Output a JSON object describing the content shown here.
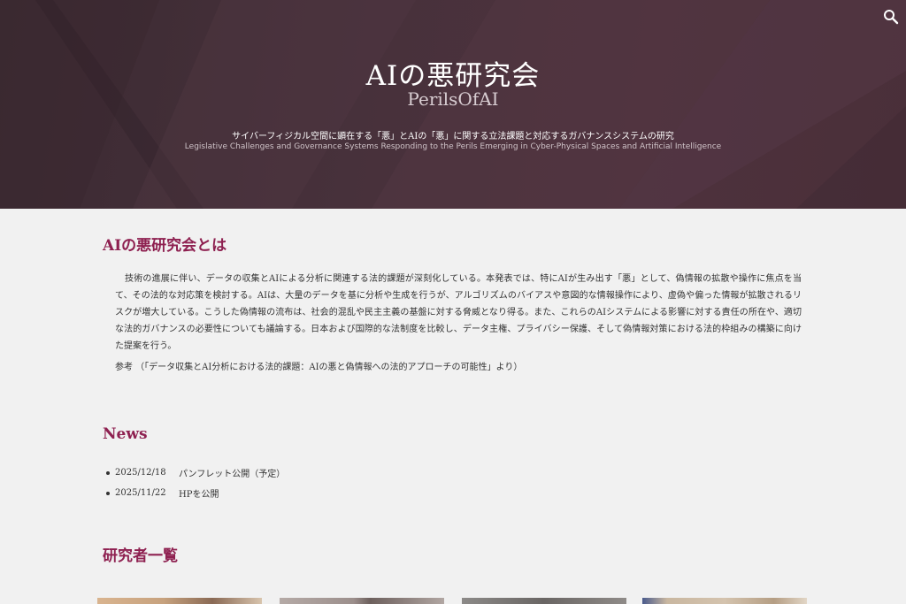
{
  "colors": {
    "hero_bg": "#47313b",
    "accent": "#8e2050",
    "page_bg": "#f1f1f1"
  },
  "header": {
    "search_icon": "search-icon",
    "title": "AIの悪研究会",
    "subtitle": "PerilsOfAI",
    "tagline_ja": "サイバーフィジカル空間に顕在する「悪」とAIの「悪」に関する立法課題と対応するガバナンスシステムの研究",
    "tagline_en": "Legislative Challenges and Governance Systems Responding to the Perils Emerging in Cyber-Physical Spaces and Artificial Intelligence"
  },
  "about": {
    "heading": "AIの悪研究会とは",
    "body": "技術の進展に伴い、データの収集とAIによる分析に関連する法的課題が深刻化している。本発表では、特にAIが生み出す「悪」として、偽情報の拡散や操作に焦点を当て、その法的な対応策を検討する。AIは、大量のデータを基に分析や生成を行うが、アルゴリズムのバイアスや意図的な情報操作により、虚偽や偏った情報が拡散されるリスクが増大している。こうした偽情報の流布は、社会的混乱や民主主義の基盤に対する脅威となり得る。また、これらのAIシステムによる影響に対する責任の所在や、適切な法的ガバナンスの必要性についても議論する。日本および国際的な法制度を比較し、データ主権、プライバシー保護、そして偽情報対策における法的枠組みの構築に向けた提案を行う。",
    "reference": "参考 （「データ収集とAI分析における法的課題：AIの悪と偽情報への法的アプローチの可能性」より）"
  },
  "news": {
    "heading": "News",
    "items": [
      {
        "date": "2025/12/18",
        "text": "パンフレット公開（予定）"
      },
      {
        "date": "2025/11/22",
        "text": "HPを公開"
      }
    ]
  },
  "researchers": {
    "heading": "研究者一覧"
  }
}
